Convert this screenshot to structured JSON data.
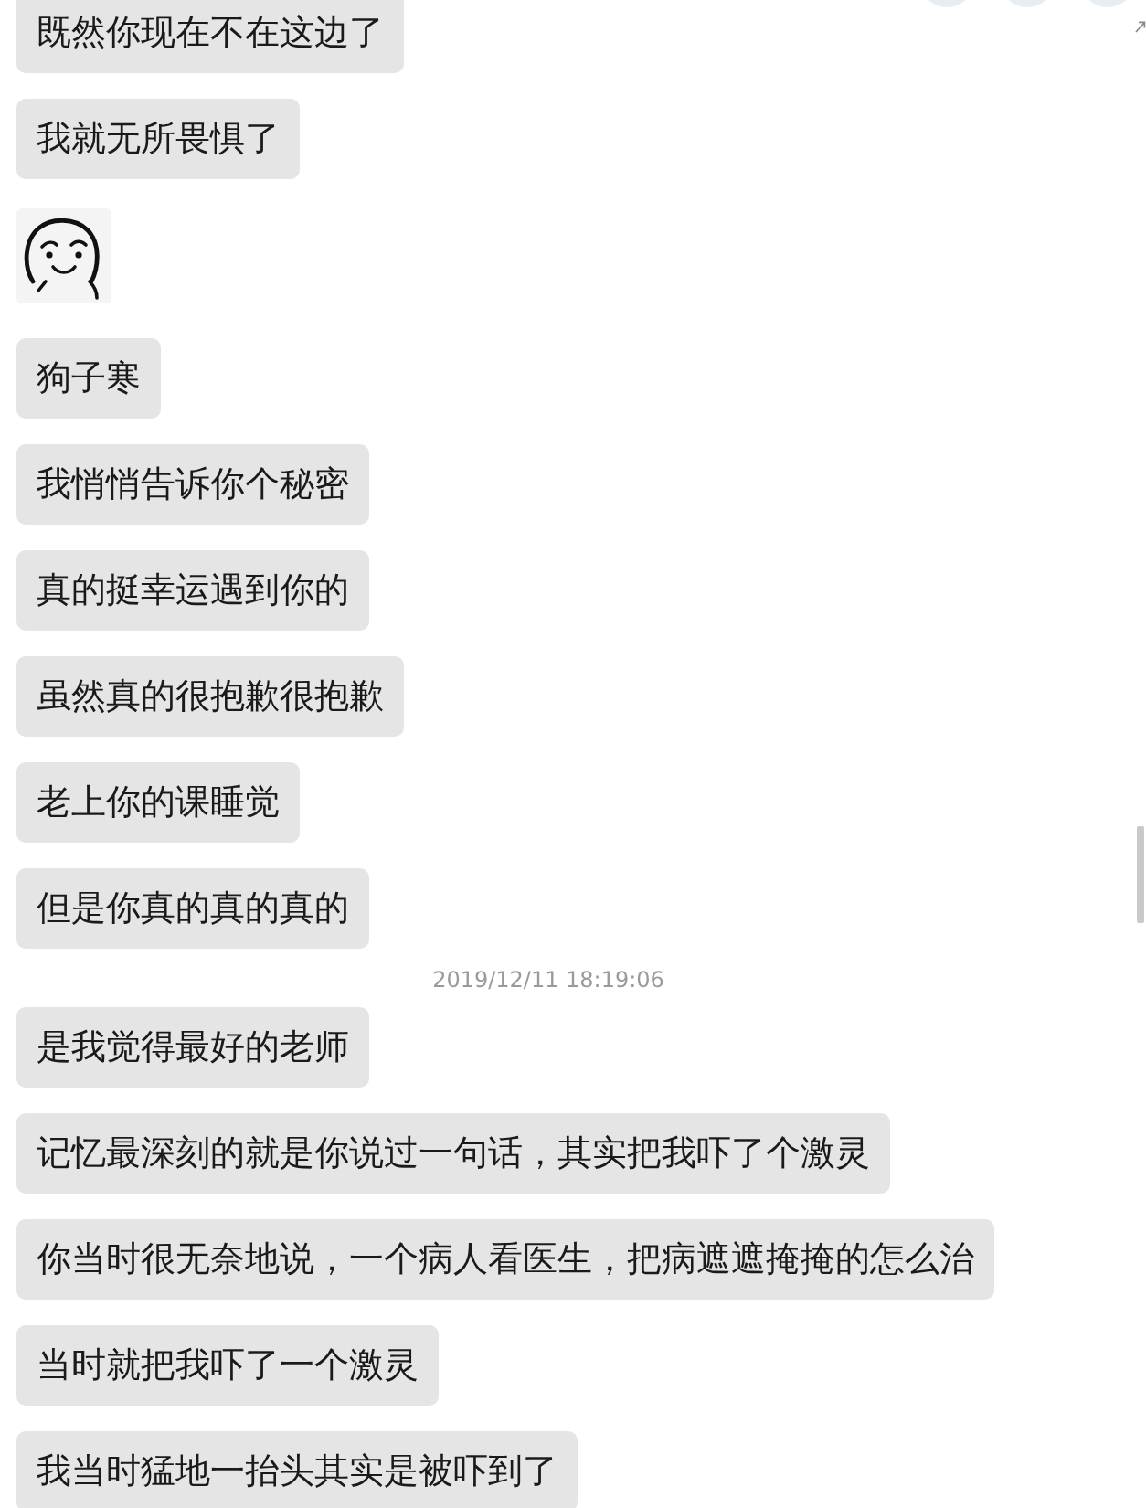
{
  "messages": [
    {
      "kind": "text",
      "text": "既然你现在不在这边了"
    },
    {
      "kind": "text",
      "text": "我就无所畏惧了"
    },
    {
      "kind": "sticker"
    },
    {
      "kind": "text",
      "text": "狗子寒"
    },
    {
      "kind": "text",
      "text": "我悄悄告诉你个秘密"
    },
    {
      "kind": "text",
      "text": "真的挺幸运遇到你的"
    },
    {
      "kind": "text",
      "text": "虽然真的很抱歉很抱歉"
    },
    {
      "kind": "text",
      "text": "老上你的课睡觉"
    },
    {
      "kind": "text",
      "text": "但是你真的真的真的"
    },
    {
      "kind": "time",
      "text": "2019/12/11 18:19:06"
    },
    {
      "kind": "text",
      "text": "是我觉得最好的老师"
    },
    {
      "kind": "text",
      "text": "记忆最深刻的就是你说过一句话，其实把我吓了个激灵"
    },
    {
      "kind": "text",
      "text": "你当时很无奈地说，一个病人看医生，把病遮遮掩掩的怎么治"
    },
    {
      "kind": "text",
      "text": "当时就把我吓了一个激灵"
    },
    {
      "kind": "text",
      "text": "我当时猛地一抬头其实是被吓到了"
    }
  ]
}
